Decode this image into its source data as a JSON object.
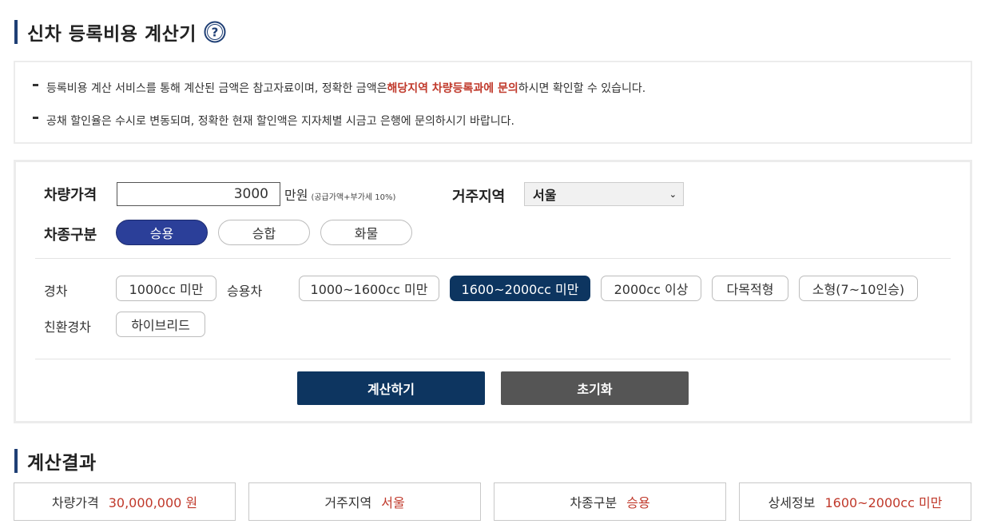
{
  "header": {
    "title": "신차 등록비용 계산기"
  },
  "notice": {
    "line1_prefix": "등록비용 계산 서비스를 통해 계산된 금액은 참고자료이며, 정확한 금액은 ",
    "line1_strong": "해당지역 차량등록과에 문의",
    "line1_suffix": "하시면 확인할 수 있습니다.",
    "line2": "공채 할인율은 수시로 변동되며, 정확한 현재 할인액은 지자체별 시금고 은행에 문의하시기 바랍니다."
  },
  "form": {
    "price_label": "차량가격",
    "price_value": "3000",
    "price_unit": "만원",
    "price_note": "(공급가액+부가세 10%)",
    "region_label": "거주지역",
    "region_selected": "서울",
    "type_label": "차종구분",
    "types": [
      "승용",
      "승합",
      "화물"
    ],
    "type_selected": "승용",
    "categories": {
      "light_label": "경차",
      "light_options": [
        "1000cc 미만"
      ],
      "passenger_label": "승용차",
      "passenger_options": [
        "1000~1600cc 미만",
        "1600~2000cc 미만",
        "2000cc 이상",
        "다목적형",
        "소형(7~10인승)"
      ],
      "passenger_selected": "1600~2000cc 미만",
      "eco_label": "친환경차",
      "eco_options": [
        "하이브리드"
      ]
    },
    "calc_button": "계산하기",
    "reset_button": "초기화"
  },
  "result": {
    "title": "계산결과",
    "items": [
      {
        "label": "차량가격",
        "value": "30,000,000 원"
      },
      {
        "label": "거주지역",
        "value": "서울"
      },
      {
        "label": "차종구분",
        "value": "승용"
      },
      {
        "label": "상세정보",
        "value": "1600~2000cc 미만"
      }
    ]
  },
  "colors": {
    "accent": "#2b3f99",
    "navy": "#0d3560",
    "highlight": "#c0392b"
  }
}
